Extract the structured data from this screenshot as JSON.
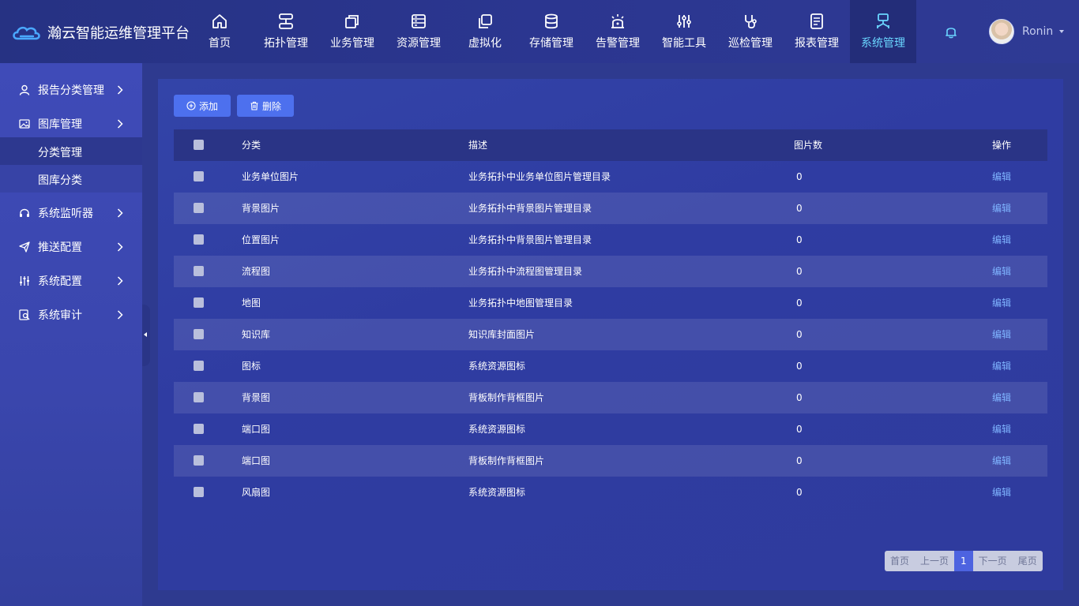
{
  "app": {
    "title": "瀚云智能运维管理平台"
  },
  "nav": [
    {
      "label": "首页",
      "icon": "home-icon"
    },
    {
      "label": "拓扑管理",
      "icon": "topology-icon"
    },
    {
      "label": "业务管理",
      "icon": "business-icon"
    },
    {
      "label": "资源管理",
      "icon": "resource-icon"
    },
    {
      "label": "虚拟化",
      "icon": "virtualization-icon"
    },
    {
      "label": "存储管理",
      "icon": "storage-icon"
    },
    {
      "label": "告警管理",
      "icon": "alarm-icon"
    },
    {
      "label": "智能工具",
      "icon": "tools-icon"
    },
    {
      "label": "巡检管理",
      "icon": "inspection-icon"
    },
    {
      "label": "报表管理",
      "icon": "report-icon"
    },
    {
      "label": "系统管理",
      "icon": "system-icon",
      "active": true
    }
  ],
  "user": {
    "name": "Ronin"
  },
  "sidebar": {
    "items": [
      {
        "label": "报告分类管理",
        "icon": "user-icon"
      },
      {
        "label": "图库管理",
        "icon": "image-icon"
      },
      {
        "label": "系统监听器",
        "icon": "headset-icon"
      },
      {
        "label": "推送配置",
        "icon": "send-icon"
      },
      {
        "label": "系统配置",
        "icon": "sliders-icon"
      },
      {
        "label": "系统审计",
        "icon": "audit-icon"
      }
    ],
    "subitems": [
      {
        "label": "分类管理",
        "active": true
      },
      {
        "label": "图库分类",
        "active": false
      }
    ]
  },
  "toolbar": {
    "add_label": "添加",
    "delete_label": "删除"
  },
  "table": {
    "headers": {
      "category": "分类",
      "description": "描述",
      "count": "图片数",
      "operation": "操作"
    },
    "edit_label": "编辑",
    "rows": [
      {
        "category": "业务单位图片",
        "description": "业务拓扑中业务单位图片管理目录",
        "count": "0"
      },
      {
        "category": "背景图片",
        "description": "业务拓扑中背景图片管理目录",
        "count": "0"
      },
      {
        "category": "位置图片",
        "description": "业务拓扑中背景图片管理目录",
        "count": "0"
      },
      {
        "category": "流程图",
        "description": "业务拓扑中流程图管理目录",
        "count": "0"
      },
      {
        "category": "地图",
        "description": "业务拓扑中地图管理目录",
        "count": "0"
      },
      {
        "category": "知识库",
        "description": "知识库封面图片",
        "count": "0"
      },
      {
        "category": "图标",
        "description": "系统资源图标",
        "count": "0"
      },
      {
        "category": "背景图",
        "description": "背板制作背框图片",
        "count": "0"
      },
      {
        "category": "端口图",
        "description": "系统资源图标",
        "count": "0"
      },
      {
        "category": "端口图",
        "description": "背板制作背框图片",
        "count": "0"
      },
      {
        "category": "风扇图",
        "description": "系统资源图标",
        "count": "0"
      }
    ]
  },
  "pagination": {
    "first": "首页",
    "prev": "上一页",
    "current": "1",
    "next": "下一页",
    "last": "尾页"
  },
  "colors": {
    "accent": "#4d70ee",
    "active_nav_text": "#6ad6ff",
    "link": "#7fb4ff"
  }
}
